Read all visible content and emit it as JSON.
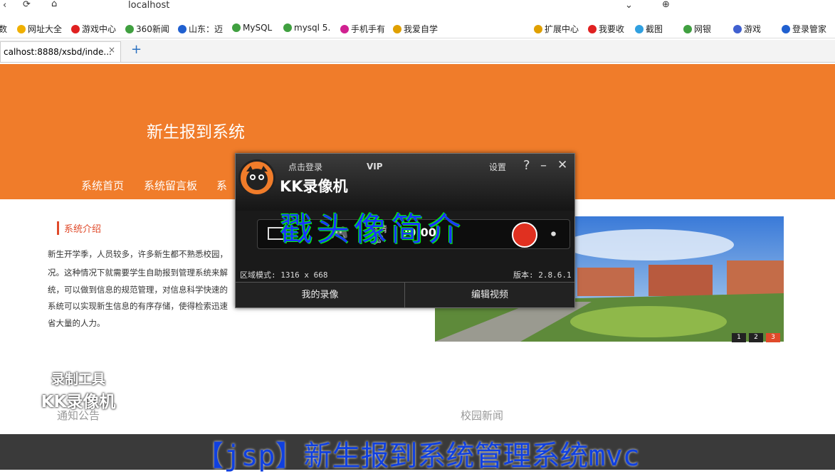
{
  "browser": {
    "address": "localhost",
    "tab_title": "calhost:8888/xsbd/inde...",
    "tab_close": "×",
    "new_tab": "+",
    "bookmarks": [
      "数",
      "网址大全",
      "游戏中心",
      "360新闻",
      "山东：迈",
      "MySQL",
      "mysql 5.",
      "手机手有",
      "我爱自学"
    ],
    "right_tools": [
      "扩展中心",
      "我要收",
      "截图",
      "网银",
      "游戏",
      "登录管家"
    ],
    "colors": {
      "banner": "#f07c2a"
    }
  },
  "site": {
    "title": "新生报到系统",
    "nav": [
      "系统首页",
      "系统留言板",
      "系"
    ],
    "intro_heading": "系统介绍",
    "intro_lines": [
      "新生开学季，人员较多，许多新生都不熟悉校园，",
      "况。这种情况下就需要学生自助报到管理系统来解",
      "统，可以做到信息的规范管理，对信息科学快速的",
      "系统可以实现新生信息的有序存储，使得检索迅速",
      "省大量的人力。"
    ],
    "pager": [
      "1",
      "2",
      "3"
    ],
    "notice_heading": "通知公告",
    "news_heading": "校园新闻"
  },
  "recorder": {
    "login": "点击登录",
    "vip": "VIP",
    "settings": "设置",
    "help": "?",
    "minimize": "–",
    "close": "✕",
    "brand": "KK录像机",
    "quality": "标清",
    "timer": "00:00",
    "overlay": "戳头像简介",
    "region": "区域模式: 1316 x 668",
    "version": "版本: 2.8.6.1",
    "my_recordings": "我的录像",
    "edit_video": "编辑视频"
  },
  "watermark": {
    "line1": "录制工具",
    "line2": "KK录像机"
  },
  "video_subtitle": "【jsp】新生报到系统管理系统mvc"
}
